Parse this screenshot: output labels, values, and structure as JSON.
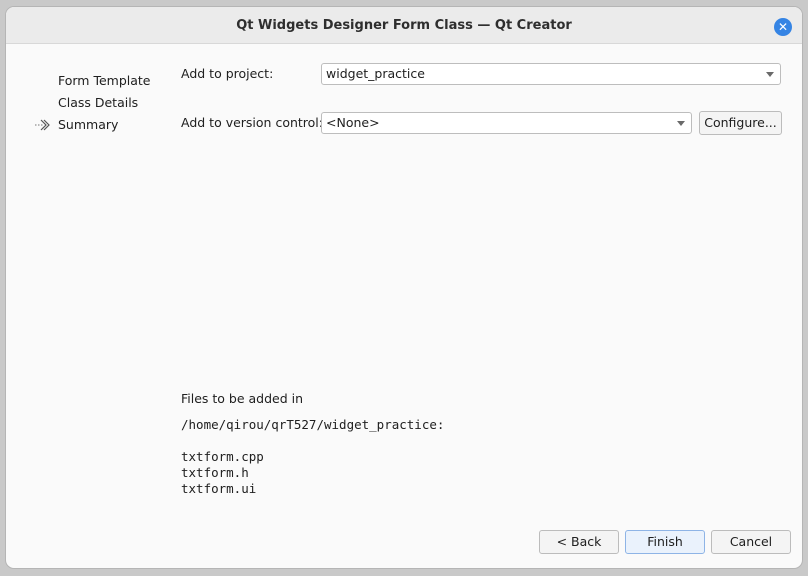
{
  "window": {
    "title": "Qt Widgets Designer Form Class — Qt Creator"
  },
  "nav": {
    "items": [
      {
        "label": "Form Template"
      },
      {
        "label": "Class Details"
      },
      {
        "label": "Summary",
        "current": true
      }
    ]
  },
  "form": {
    "project_label": "Add to project:",
    "project_value": "widget_practice",
    "vcs_label": "Add to version control:",
    "vcs_value": "<None>",
    "configure_label": "Configure..."
  },
  "files": {
    "heading": "Files to be added in",
    "directory": "/home/qirou/qrT527/widget_practice:",
    "list": [
      "txtform.cpp",
      "txtform.h",
      "txtform.ui"
    ]
  },
  "buttons": {
    "back": "< Back",
    "finish": "Finish",
    "cancel": "Cancel"
  },
  "colors": {
    "accent": "#3584e4",
    "background": "#fafafa",
    "titlebar": "#ebebeb"
  },
  "icons": {
    "close": "close-icon",
    "current_step": "chevron-right-icon",
    "dropdown": "chevron-down-icon"
  }
}
